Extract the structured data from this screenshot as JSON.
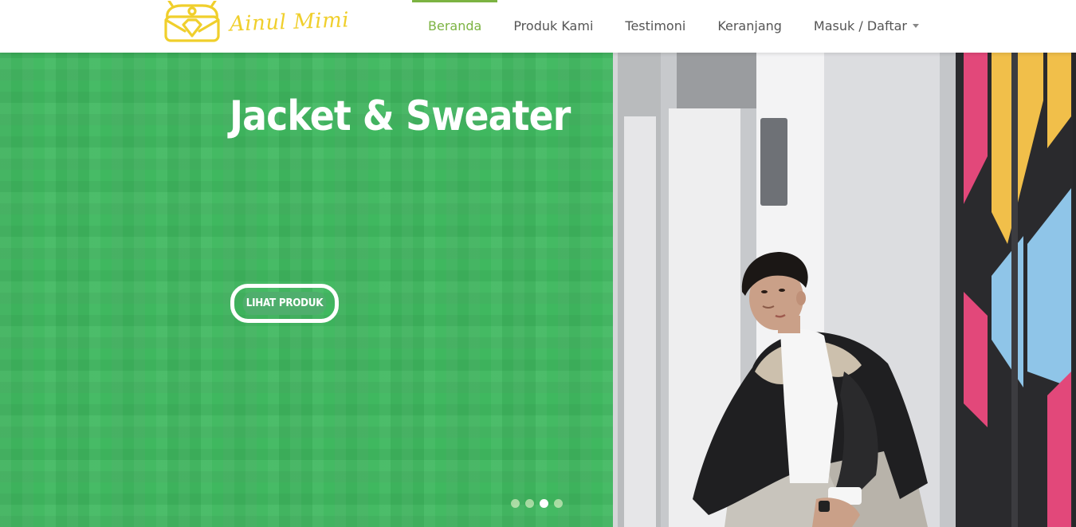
{
  "brand": {
    "name": "Ainul Mimi",
    "logo_icon": "bag-icon",
    "color": "#f0cf2c"
  },
  "nav": {
    "items": [
      {
        "label": "Beranda",
        "active": true
      },
      {
        "label": "Produk Kami",
        "active": false
      },
      {
        "label": "Testimoni",
        "active": false
      },
      {
        "label": "Keranjang",
        "active": false
      },
      {
        "label": "Masuk / Daftar",
        "active": false,
        "dropdown": true
      }
    ],
    "active_color": "#7cb342"
  },
  "hero": {
    "title": "Jacket & Sweater",
    "button_label": "LIHAT PRODUK",
    "background_color": "#3fb85f",
    "slides_count": 4,
    "active_slide": 3
  }
}
